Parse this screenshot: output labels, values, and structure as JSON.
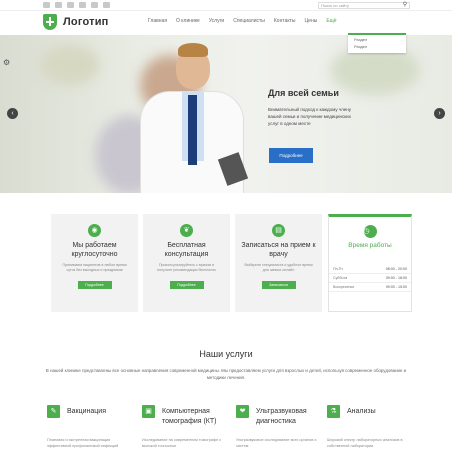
{
  "topbar": {
    "social_icons": [
      "facebook-icon",
      "twitter-icon",
      "google-plus-icon",
      "vk-icon",
      "linkedin-icon",
      "rss-icon"
    ],
    "search_placeholder": "Поиск по сайту",
    "search_icon": "search-icon"
  },
  "header": {
    "logo_text": "Логотип",
    "nav": [
      "Главная",
      "О клинике",
      "Услуги",
      "Специалисты",
      "Контакты",
      "Цены",
      "Ещё"
    ],
    "dropdown": [
      "Раздел",
      "Раздел"
    ]
  },
  "hero": {
    "title": "Для всей семьи",
    "description": "Внимательный подход к каждому члену вашей семьи и получение медицинских услуг в одном месте",
    "button": "Подробнее"
  },
  "cards": [
    {
      "title": "Мы работаем круглосуточно",
      "text": "Принимаем пациентов в любое время суток без выходных и праздников",
      "button": "Подробнее",
      "icon": "camera-icon"
    },
    {
      "title": "Бесплатная консультация",
      "text": "Проконсультируйтесь с врачом и получите рекомендации бесплатно",
      "button": "Подробнее",
      "icon": "stethoscope-icon"
    },
    {
      "title": "Записаться на прием к врачу",
      "text": "Выберите специалиста и удобное время для записи онлайн",
      "button": "Записаться",
      "icon": "calendar-icon"
    }
  ],
  "hours": {
    "title": "Время работы",
    "rows": [
      {
        "day": "Пн-Пт",
        "time": "08:00 - 20:00"
      },
      {
        "day": "Суббота",
        "time": "09:00 - 18:00"
      },
      {
        "day": "Воскресенье",
        "time": "09:00 - 15:00"
      }
    ],
    "icon": "clock-icon"
  },
  "services": {
    "title": "Наши услуги",
    "description": "В нашей клинике представлены все основные направления современной медицины. Мы предоставляем услуги для взрослых и детей, используя современное оборудование и методики лечения.",
    "items": [
      {
        "title": "Вакцинация",
        "text": "Плановая и экстренная вакцинация эффективной профилактикой инфекций",
        "icon": "syringe-icon"
      },
      {
        "title": "Компьютерная томография (КТ)",
        "text": "Исследование на современном томографе с высокой точностью",
        "icon": "scan-icon"
      },
      {
        "title": "Ультразвуковая диагностика",
        "text": "Ультразвуковое исследование всех органов и систем",
        "icon": "heart-icon"
      },
      {
        "title": "Анализы",
        "text": "Широкий спектр лабораторных анализов в собственной лаборатории",
        "icon": "flask-icon"
      }
    ]
  },
  "colors": {
    "accent": "#4cae4c",
    "hero_button": "#2a6fc7"
  }
}
